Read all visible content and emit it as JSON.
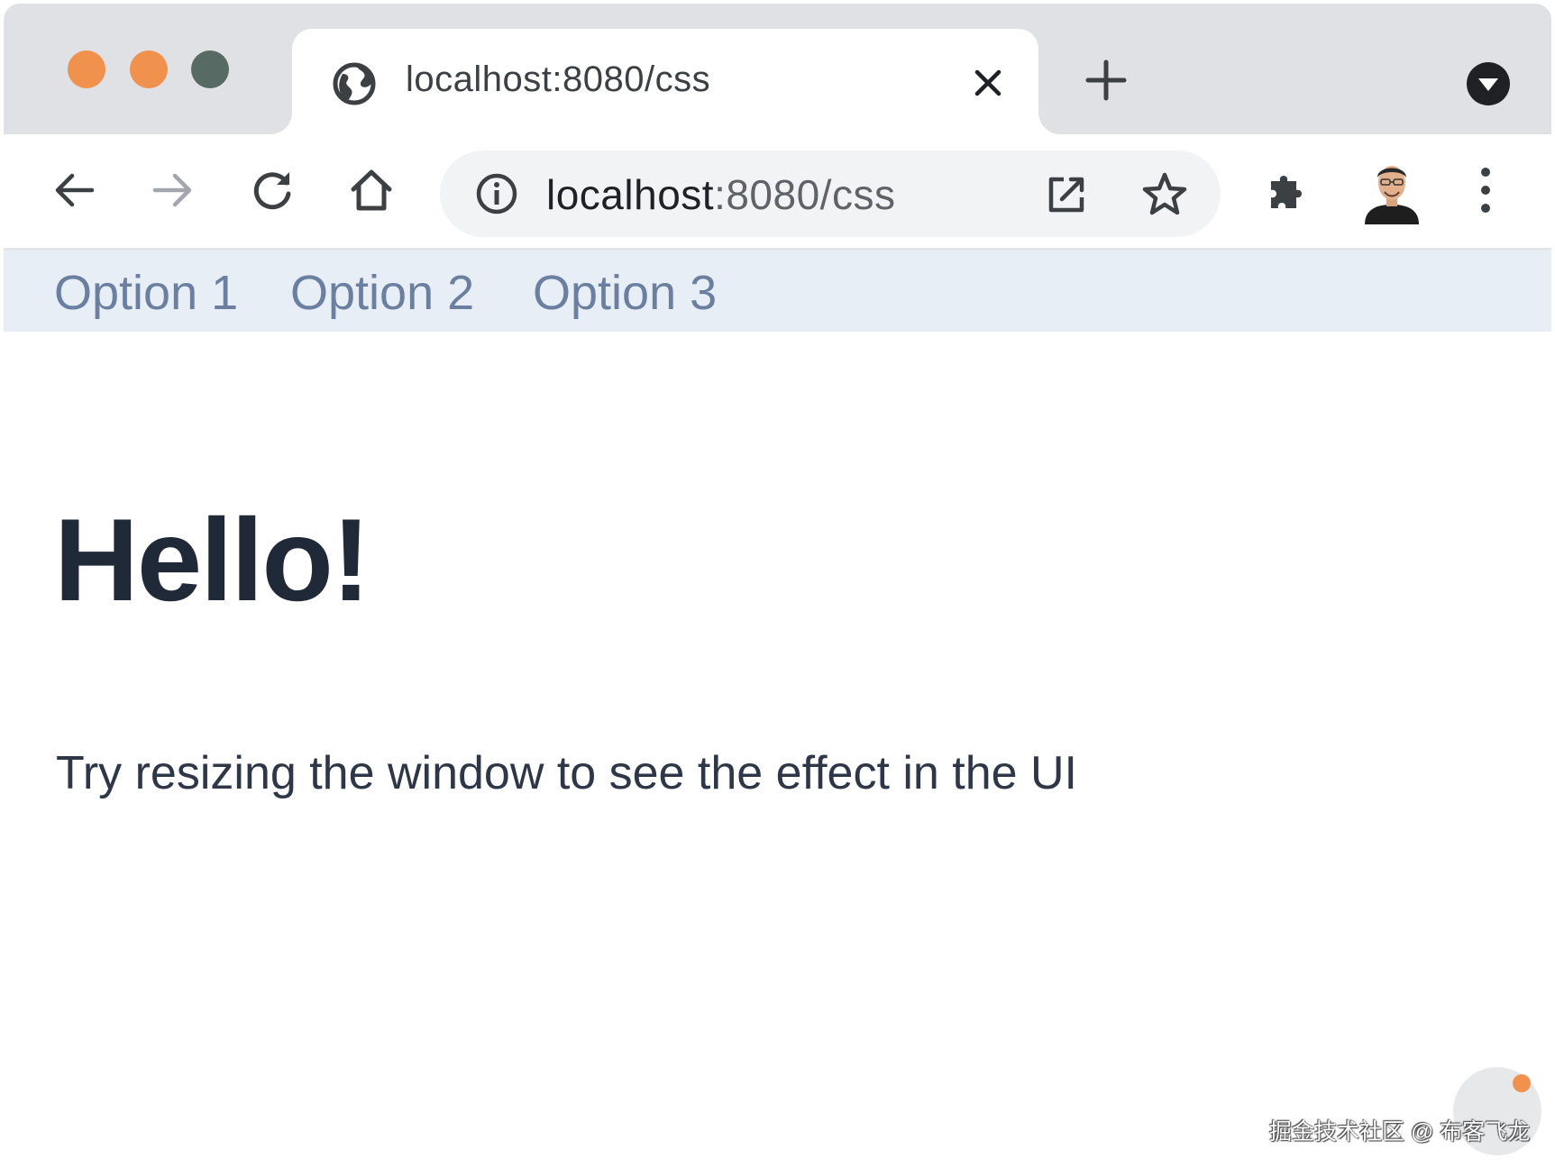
{
  "browser": {
    "tab": {
      "title": "localhost:8080/css"
    },
    "omnibox": {
      "host": "localhost",
      "path": ":8080/css"
    },
    "icons": {
      "tab_favicon": "globe-icon",
      "tab_close": "close-icon",
      "new_tab": "plus-icon",
      "tab_search": "chevron-down-icon",
      "back": "arrow-left-icon",
      "forward": "arrow-right-icon",
      "reload": "reload-icon",
      "home": "home-icon",
      "site_info": "info-icon",
      "open_in_app": "open-external-icon",
      "bookmark": "star-icon",
      "extensions": "puzzle-icon",
      "menu": "vertical-dots-icon"
    }
  },
  "page": {
    "nav": [
      "Option 1",
      "Option 2",
      "Option 3"
    ],
    "heading": "Hello!",
    "paragraph": "Try resizing the window to see the effect in the UI"
  },
  "watermark": {
    "text": "掘金技术社区 @ 布客飞龙"
  },
  "colors": {
    "tab_strip": "#dfe1e5",
    "traffic_close": "#f0914e",
    "traffic_minimize": "#f0914e",
    "traffic_maximize": "#586a64",
    "nav_background": "#e8eef5",
    "nav_link": "#6b7fa0",
    "heading": "#1f2937",
    "paragraph": "#2d3748"
  }
}
